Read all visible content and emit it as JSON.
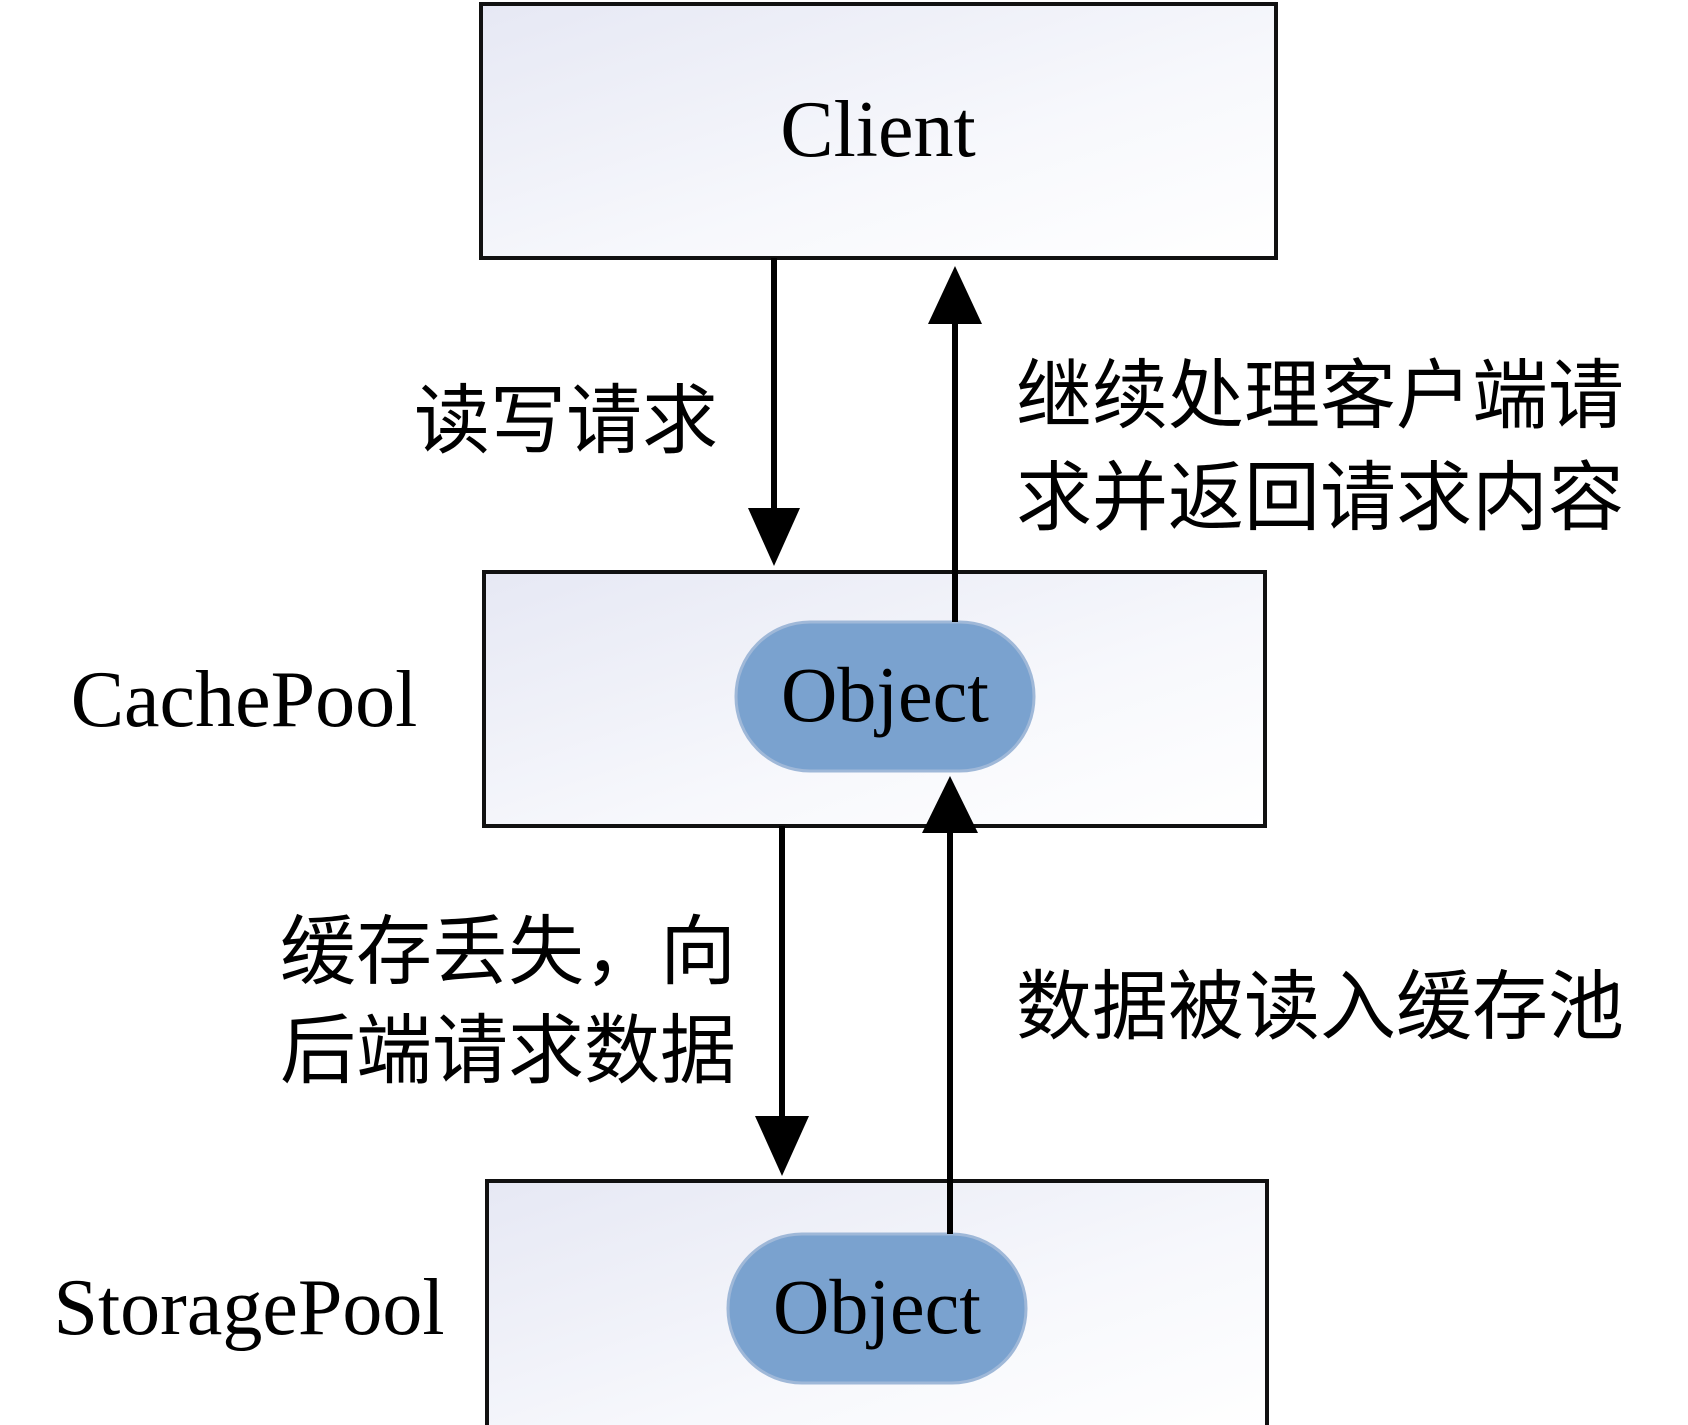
{
  "diagram": {
    "nodes": {
      "client": {
        "label": "Client"
      },
      "cache_pool": {
        "label": "CachePool",
        "object_label": "Object"
      },
      "storage_pool": {
        "label": "StoragePool",
        "object_label": "Object"
      }
    },
    "edges": {
      "read_write_request": {
        "label": "读写请求"
      },
      "continue_processing": {
        "label_lines": [
          "继续处理客户端请",
          "求并返回请求内容"
        ]
      },
      "cache_miss": {
        "label_lines": [
          "缓存丢失，向",
          "后端请求数据"
        ]
      },
      "data_read_into_cache": {
        "label": "数据被读入缓存池"
      }
    },
    "colors": {
      "box_stroke": "#111111",
      "box_fill_start": "#e6e8f4",
      "box_fill_end": "#ffffff",
      "object_fill": "#7aa2cf",
      "object_stroke": "#9fb8d8",
      "arrow": "#000000",
      "text": "#000000"
    }
  }
}
